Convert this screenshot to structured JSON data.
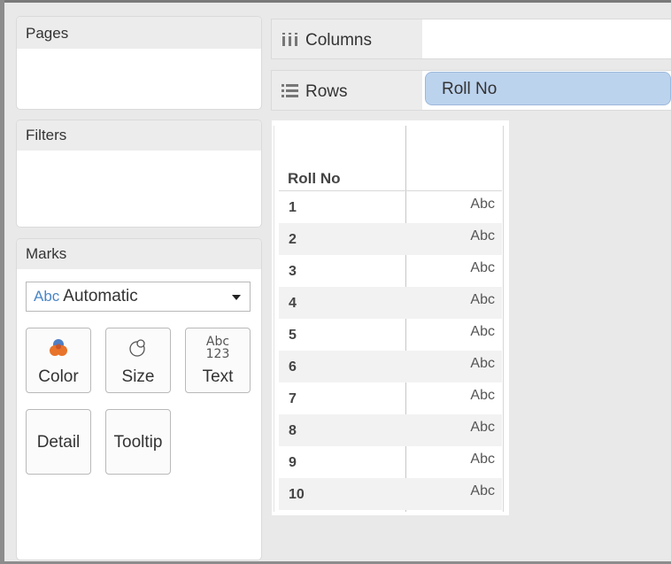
{
  "panels": {
    "pages": "Pages",
    "filters": "Filters",
    "marks": "Marks"
  },
  "marks_card": {
    "type_icon_text": "Abc",
    "type_value": "Automatic",
    "buttons": {
      "color": "Color",
      "size": "Size",
      "text": "Text",
      "text_icon_line1": "Abc",
      "text_icon_line2": "123",
      "detail": "Detail",
      "tooltip": "Tooltip"
    },
    "color_icon_colors": [
      "#e8732a",
      "#4f7fc4"
    ]
  },
  "shelves": {
    "columns_label": "Columns",
    "rows_label": "Rows",
    "rows_pill": "Roll No"
  },
  "view": {
    "column_header": "Roll No",
    "rows": [
      {
        "roll": "1",
        "value": "Abc"
      },
      {
        "roll": "2",
        "value": "Abc"
      },
      {
        "roll": "3",
        "value": "Abc"
      },
      {
        "roll": "4",
        "value": "Abc"
      },
      {
        "roll": "5",
        "value": "Abc"
      },
      {
        "roll": "6",
        "value": "Abc"
      },
      {
        "roll": "7",
        "value": "Abc"
      },
      {
        "roll": "8",
        "value": "Abc"
      },
      {
        "roll": "9",
        "value": "Abc"
      },
      {
        "roll": "10",
        "value": "Abc"
      }
    ]
  },
  "colors": {
    "pill_fill": "#bcd3ee",
    "accent_blue": "#4a86c6"
  }
}
